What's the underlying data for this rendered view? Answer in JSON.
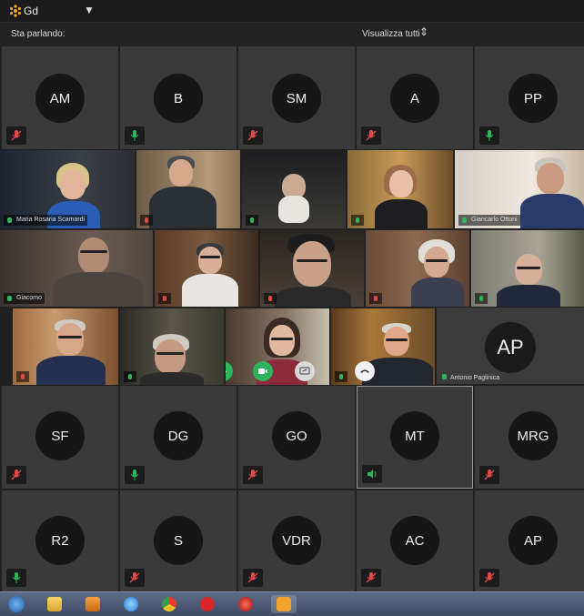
{
  "window": {
    "title": "Gd",
    "logo": "meet-snowflake-icon"
  },
  "header": {
    "speaking_label": "Sta parlando:",
    "view_all_label": "Visualizza tutti"
  },
  "colors": {
    "mic_on": "#2db55d",
    "mic_off": "#e04a4a",
    "tile_bg": "#3a3a3a",
    "avatar_bg": "#161616"
  },
  "top_tiles": [
    {
      "initials": "AM",
      "mic": "off"
    },
    {
      "initials": "B",
      "mic": "on"
    },
    {
      "initials": "SM",
      "mic": "off"
    },
    {
      "initials": "A",
      "mic": "off"
    },
    {
      "initials": "PP",
      "mic": "on"
    }
  ],
  "video_tiles": [
    {
      "name": "Maria Rosaria Scamardi",
      "mic": "on"
    },
    {
      "name": "",
      "mic": "off"
    },
    {
      "name": "",
      "mic": "on"
    },
    {
      "name": "",
      "mic": "on"
    },
    {
      "name": "Giancarlo Ottoni",
      "mic": "on"
    },
    {
      "name": "Giacomo",
      "mic": "on"
    },
    {
      "name": "",
      "mic": "off"
    },
    {
      "name": "",
      "mic": "off"
    },
    {
      "name": "",
      "mic": "off"
    },
    {
      "name": "",
      "mic": "on"
    },
    {
      "name": "",
      "mic": "off"
    },
    {
      "name": "",
      "mic": "off"
    },
    {
      "name": "",
      "mic": "off"
    },
    {
      "name": "",
      "mic": "on"
    }
  ],
  "self_controls": {
    "mic": "microphone-icon",
    "camera": "camera-icon",
    "present": "present-icon",
    "hangup": "hangup-icon"
  },
  "ap_large": {
    "initials": "AP",
    "name": "Antonio Paglinica"
  },
  "row5_tiles": [
    {
      "initials": "SF",
      "mic": "off"
    },
    {
      "initials": "DG",
      "mic": "on"
    },
    {
      "initials": "GO",
      "mic": "off"
    },
    {
      "initials": "MT",
      "mic": "speaking"
    },
    {
      "initials": "MRG",
      "mic": "off"
    }
  ],
  "row6_tiles": [
    {
      "initials": "R2",
      "mic": "on"
    },
    {
      "initials": "S",
      "mic": "off"
    },
    {
      "initials": "VDR",
      "mic": "off"
    },
    {
      "initials": "AC",
      "mic": "off"
    },
    {
      "initials": "AP",
      "mic": "off"
    }
  ],
  "taskbar": {
    "items": [
      "windows-start-icon",
      "file-explorer-icon",
      "media-player-icon",
      "internet-explorer-icon",
      "chrome-icon",
      "opera-icon",
      "security-app-icon",
      "meet-app-icon"
    ]
  }
}
